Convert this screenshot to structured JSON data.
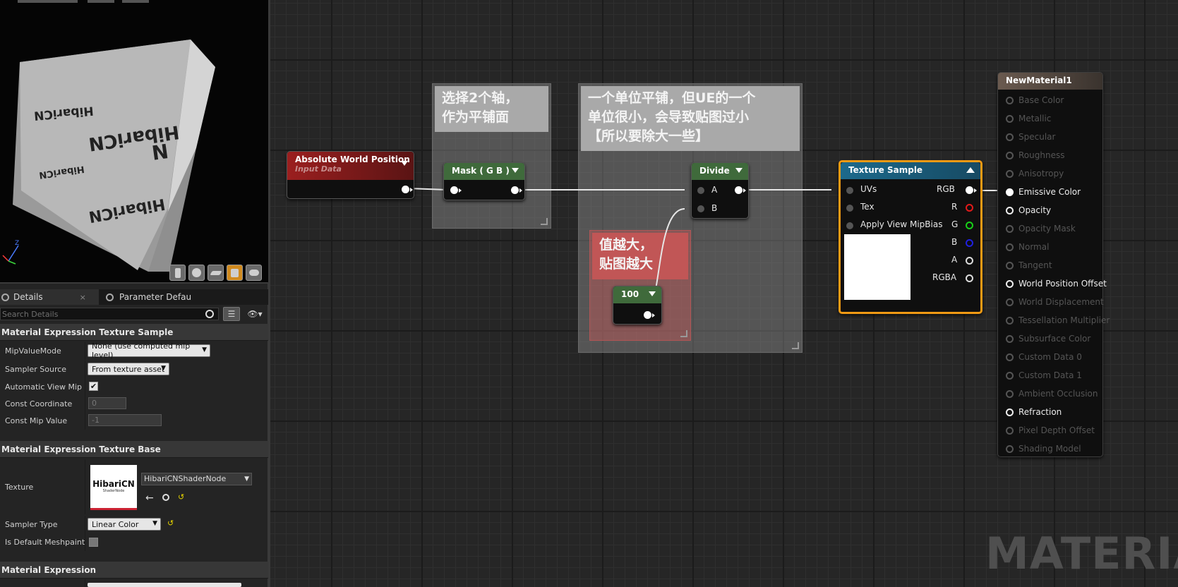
{
  "viewport": {
    "cube_texts": [
      "HibariCN",
      "HibariCN",
      "HibariCN",
      "HibariCN",
      "N"
    ],
    "toolbar_icons": [
      "cylinder-icon",
      "sphere-icon",
      "plane-icon",
      "cube-icon",
      "teapot-icon"
    ],
    "axis_label": "Z"
  },
  "tabs": [
    {
      "label": "Details",
      "close": "×"
    },
    {
      "label": "Parameter Defaults"
    }
  ],
  "search": {
    "placeholder": "Search Details"
  },
  "details": {
    "sections": [
      "Material Expression Texture Sample",
      "Material Expression Texture Base",
      "Material Expression"
    ],
    "mip_value_mode": {
      "label": "MipValueMode",
      "value": "None (use computed mip level)"
    },
    "sampler_source": {
      "label": "Sampler Source",
      "value": "From texture asset"
    },
    "auto_view_mip": {
      "label": "Automatic View Mip Bi",
      "checked": "✔"
    },
    "const_coordinate": {
      "label": "Const Coordinate",
      "value": "0"
    },
    "const_mip_value": {
      "label": "Const Mip Value",
      "value": "-1"
    },
    "texture": {
      "label": "Texture",
      "asset": "HibariCNShaderNode",
      "thumb_title": "HibariCN",
      "thumb_sub": "ShaderNode"
    },
    "sampler_type": {
      "label": "Sampler Type",
      "value": "Linear Color"
    },
    "is_default_meshpaint": {
      "label": "Is Default Meshpaint T"
    }
  },
  "graph": {
    "comments": [
      {
        "text": "选择2个轴，\n作为平铺面"
      },
      {
        "text": "一个单位平铺，但UE的一个\n单位很小，会导致贴图过小\n【所以要除大一些】"
      },
      {
        "text": "值越大，\n贴图越大"
      }
    ],
    "nodes": {
      "abs_world_pos": {
        "title": "Absolute World Position",
        "subtitle": "Input Data"
      },
      "mask": {
        "title": "Mask ( G B )"
      },
      "divide": {
        "title": "Divide",
        "pin_a": "A",
        "pin_b": "B"
      },
      "constant": {
        "title": "100"
      },
      "texture_sample": {
        "title": "Texture Sample",
        "inputs": [
          "UVs",
          "Tex",
          "Apply View MipBias"
        ],
        "outputs": [
          "RGB",
          "R",
          "G",
          "B",
          "A",
          "RGBA"
        ]
      },
      "material": {
        "title": "NewMaterial1",
        "pins": [
          {
            "label": "Base Color",
            "on": false
          },
          {
            "label": "Metallic",
            "on": false
          },
          {
            "label": "Specular",
            "on": false
          },
          {
            "label": "Roughness",
            "on": false
          },
          {
            "label": "Anisotropy",
            "on": false
          },
          {
            "label": "Emissive Color",
            "on": true,
            "connected": true
          },
          {
            "label": "Opacity",
            "on": true
          },
          {
            "label": "Opacity Mask",
            "on": false
          },
          {
            "label": "Normal",
            "on": false
          },
          {
            "label": "Tangent",
            "on": false
          },
          {
            "label": "World Position Offset",
            "on": true
          },
          {
            "label": "World Displacement",
            "on": false
          },
          {
            "label": "Tessellation Multiplier",
            "on": false
          },
          {
            "label": "Subsurface Color",
            "on": false
          },
          {
            "label": "Custom Data 0",
            "on": false
          },
          {
            "label": "Custom Data 1",
            "on": false
          },
          {
            "label": "Ambient Occlusion",
            "on": false
          },
          {
            "label": "Refraction",
            "on": true
          },
          {
            "label": "Pixel Depth Offset",
            "on": false
          },
          {
            "label": "Shading Model",
            "on": false
          }
        ]
      }
    },
    "watermark": "MATERIAL"
  },
  "colors": {
    "input_header": "#8a1c1c",
    "green_header": "#3f6a3b",
    "texture_header": "#1b5d7a",
    "selection": "#f09a14",
    "material_header": "#5a4d44"
  }
}
